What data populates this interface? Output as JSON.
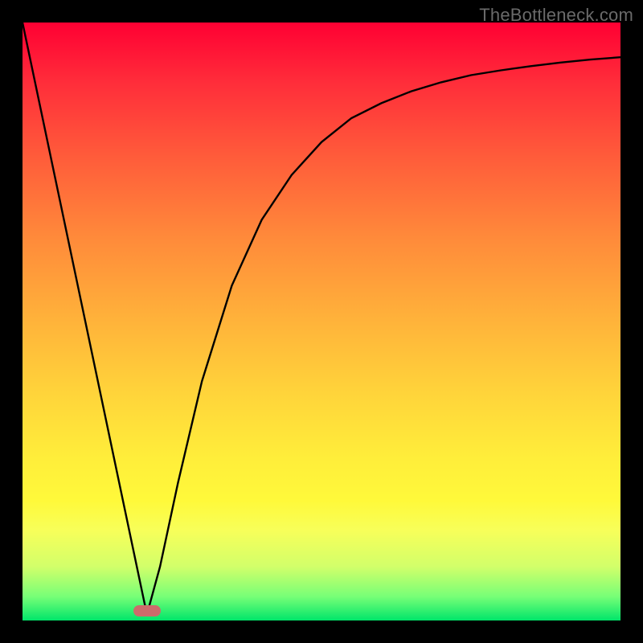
{
  "watermark": "TheBottleneck.com",
  "frame": {
    "outer_size": 800,
    "border": 28,
    "bg": "#000000"
  },
  "gradient_stops": [
    {
      "pos": 0.0,
      "color": "#ff0033"
    },
    {
      "pos": 0.5,
      "color": "#ffb33a"
    },
    {
      "pos": 0.8,
      "color": "#fff93a"
    },
    {
      "pos": 1.0,
      "color": "#00e56a"
    }
  ],
  "marker": {
    "x_frac": 0.208,
    "y_frac": 0.984,
    "color": "#cc6b6b"
  },
  "chart_data": {
    "type": "line",
    "title": "",
    "xlabel": "",
    "ylabel": "",
    "xlim": [
      0,
      1
    ],
    "ylim": [
      0,
      1
    ],
    "series": [
      {
        "name": "curve",
        "x": [
          0.0,
          0.05,
          0.1,
          0.15,
          0.2,
          0.208,
          0.23,
          0.26,
          0.3,
          0.35,
          0.4,
          0.45,
          0.5,
          0.55,
          0.6,
          0.65,
          0.7,
          0.75,
          0.8,
          0.85,
          0.9,
          0.95,
          1.0
        ],
        "y": [
          1.0,
          0.762,
          0.524,
          0.286,
          0.048,
          0.01,
          0.09,
          0.23,
          0.4,
          0.56,
          0.67,
          0.745,
          0.8,
          0.84,
          0.865,
          0.885,
          0.9,
          0.912,
          0.92,
          0.927,
          0.933,
          0.938,
          0.942
        ]
      }
    ],
    "annotations": []
  }
}
